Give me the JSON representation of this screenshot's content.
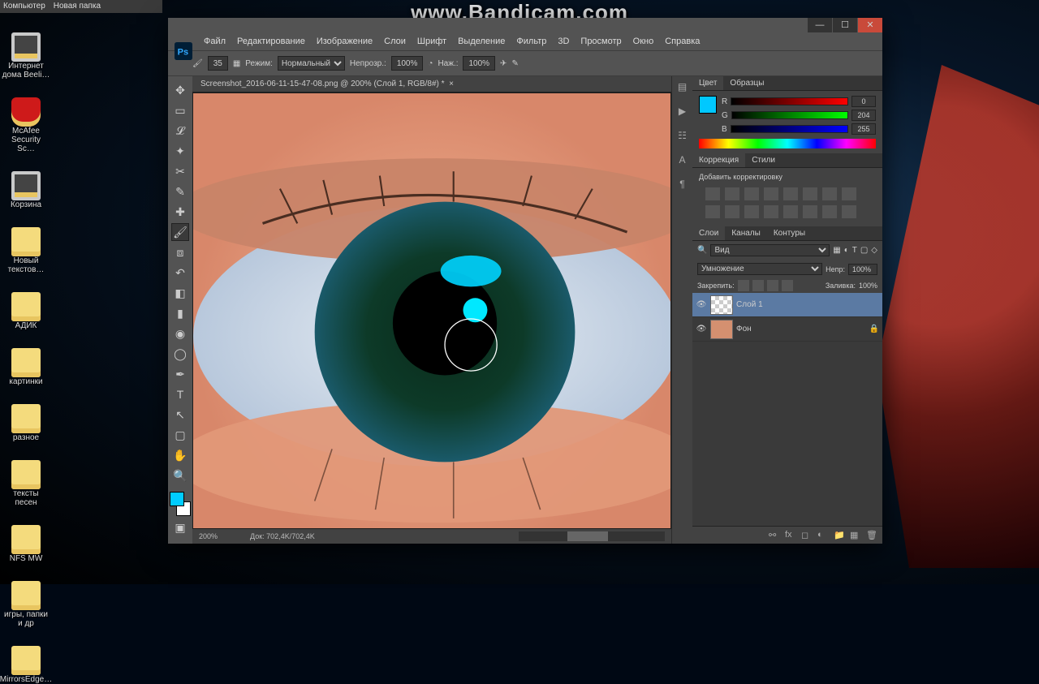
{
  "watermark": "www.Bandicam.com",
  "taskbar": {
    "computer": "Компьютер",
    "new_folder": "Новая папка"
  },
  "desktop_icons": [
    {
      "label": "Интернет дома Beeli…"
    },
    {
      "label": "McAfee Security Sc…"
    },
    {
      "label": "Корзина"
    },
    {
      "label": "Новый текстов…"
    },
    {
      "label": "АДИК"
    },
    {
      "label": "картинки"
    },
    {
      "label": "разное"
    },
    {
      "label": "тексты песен"
    },
    {
      "label": "NFS MW"
    },
    {
      "label": "игры, папки и др"
    },
    {
      "label": "MirrorsEdge…"
    }
  ],
  "menu": [
    "Файл",
    "Редактирование",
    "Изображение",
    "Слои",
    "Шрифт",
    "Выделение",
    "Фильтр",
    "3D",
    "Просмотр",
    "Окно",
    "Справка"
  ],
  "options": {
    "brush_size": "35",
    "mode_label": "Режим:",
    "mode_value": "Нормальный",
    "opacity_label": "Непрозр.:",
    "opacity_value": "100%",
    "flow_label": "Наж.:",
    "flow_value": "100%"
  },
  "doc_tab": "Screenshot_2016-06-11-15-47-08.png @ 200% (Слой 1, RGB/8#) *",
  "status": {
    "zoom": "200%",
    "doc": "Док: 702,4K/702,4K"
  },
  "color_panel": {
    "tab1": "Цвет",
    "tab2": "Образцы",
    "r": "0",
    "g": "204",
    "b": "255"
  },
  "correction_panel": {
    "tab1": "Коррекция",
    "tab2": "Стили",
    "subtitle": "Добавить корректировку"
  },
  "layers_panel": {
    "tab1": "Слои",
    "tab2": "Каналы",
    "tab3": "Контуры",
    "kind": "Вид",
    "blend": "Умножение",
    "opacity_label": "Непр:",
    "opacity_value": "100%",
    "lock_label": "Закрепить:",
    "fill_label": "Заливка:",
    "fill_value": "100%",
    "layers": [
      {
        "name": "Слой 1",
        "selected": true
      },
      {
        "name": "Фон",
        "bg": true
      }
    ]
  }
}
